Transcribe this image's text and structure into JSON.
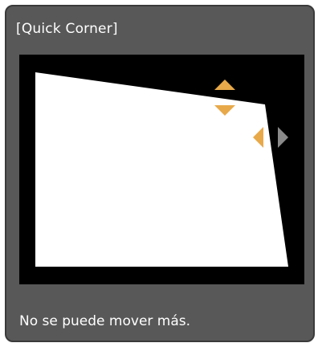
{
  "dialog": {
    "title": "[Quick Corner]",
    "message": "No se puede mover más."
  },
  "colors": {
    "panel": "#585858",
    "preview_background": "#000000",
    "image_area": "#ffffff",
    "arrow_enabled": "#e8a94a",
    "arrow_disabled": "#8a8a8a",
    "text": "#ffffff"
  },
  "corner_arrows": {
    "up": "enabled",
    "down": "enabled",
    "left": "enabled",
    "right": "disabled"
  }
}
